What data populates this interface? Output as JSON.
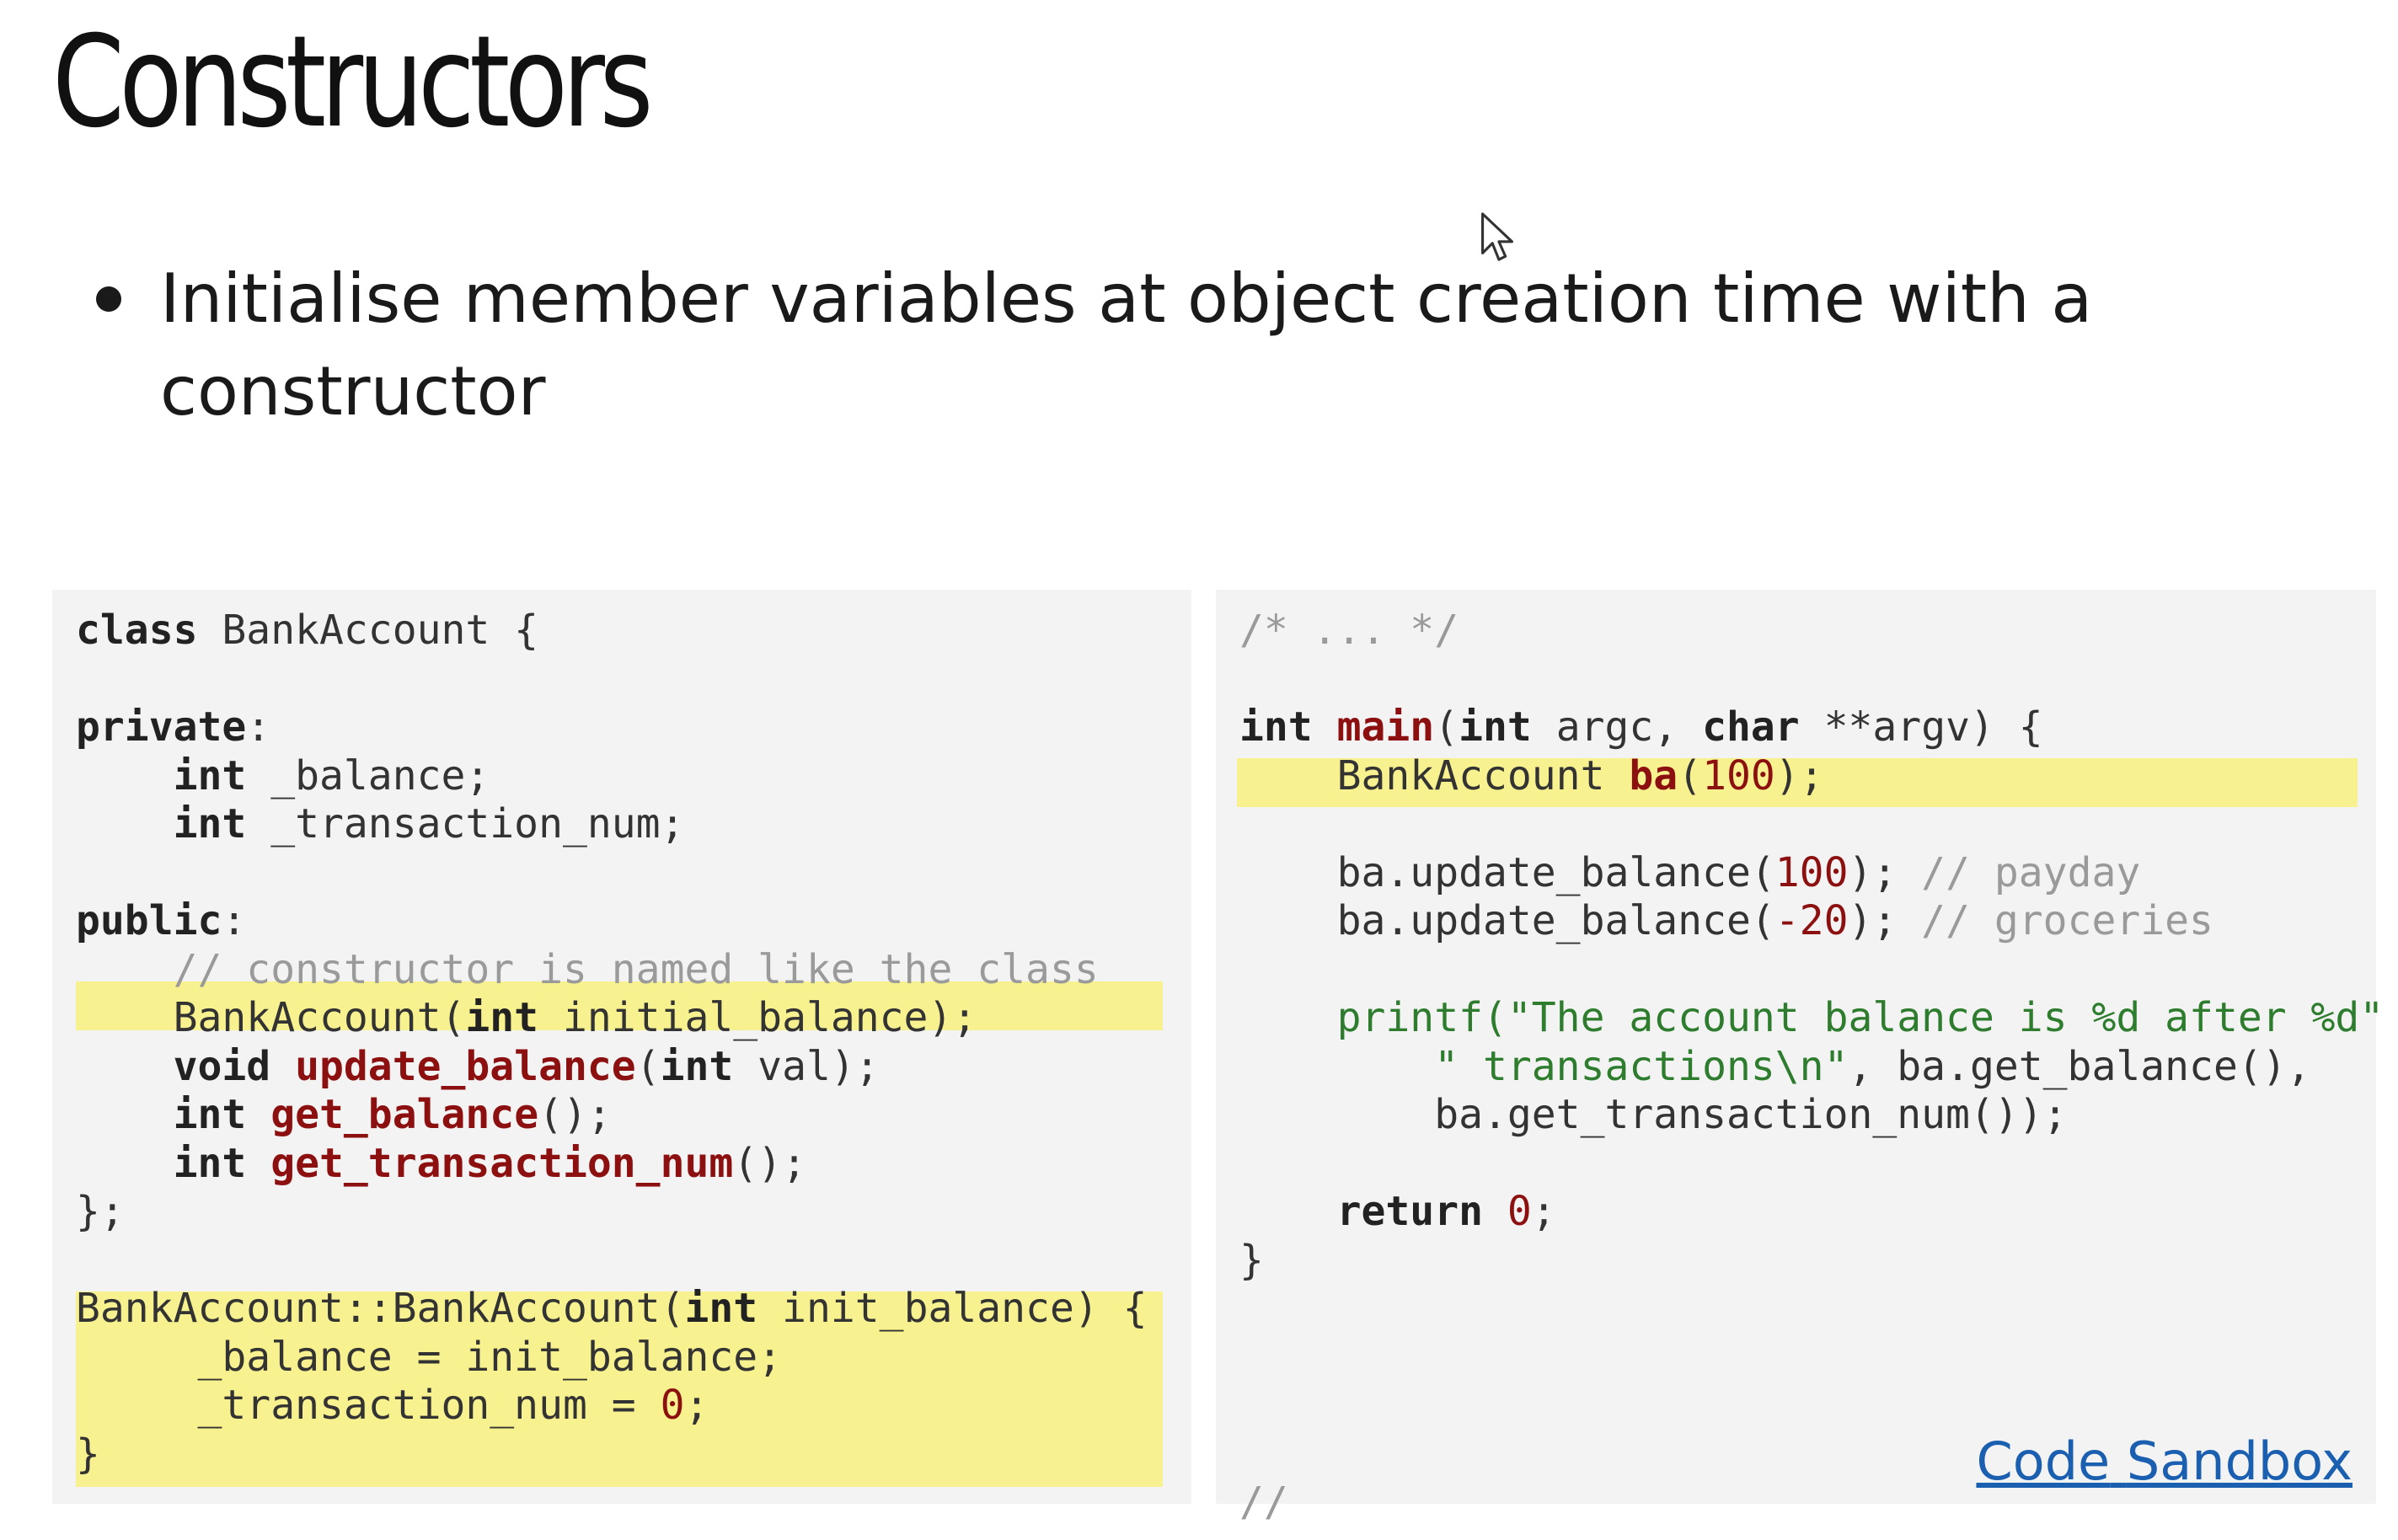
{
  "slide": {
    "title": "Constructors",
    "bullets": [
      "Initialise member variables at object creation time with a constructor"
    ]
  },
  "left_code": {
    "l01a": "class",
    "l01b": " BankAccount {",
    "l03a": "private",
    "l03b": ":",
    "l04a": "int",
    "l04b": " _balance;",
    "l05a": "int",
    "l05b": " _transaction_num;",
    "l07a": "public",
    "l07b": ":",
    "l08": "// constructor is named like the class",
    "l09a": "BankAccount(",
    "l09b": "int",
    "l09c": " initial_balance);",
    "l10a": "void",
    "l10b": "update_balance",
    "l10c": "(",
    "l10d": "int",
    "l10e": " val);",
    "l11a": "int",
    "l11b": "get_balance",
    "l11c": "();",
    "l12a": "int",
    "l12b": "get_transaction_num",
    "l12c": "();",
    "l13": "};",
    "l15a": "BankAccount::BankAccount(",
    "l15b": "int",
    "l15c": " init_balance) {",
    "l16": "_balance = init_balance;",
    "l17a": "_transaction_num = ",
    "l17b": "0",
    "l17c": ";",
    "l18": "}"
  },
  "right_code": {
    "r01": "/* ... */",
    "r03a": "int",
    "r03b": "main",
    "r03c": "(",
    "r03d": "int",
    "r03e": " argc, ",
    "r03f": "char",
    "r03g": " **argv) {",
    "r04a": "BankAccount ",
    "r04b": "ba",
    "r04c": "(",
    "r04d": "100",
    "r04e": ");",
    "r06a": "ba.update_balance(",
    "r06b": "100",
    "r06c": "); ",
    "r06d": "// payday",
    "r07a": "ba.update_balance(",
    "r07b": "-20",
    "r07c": "); ",
    "r07d": "// groceries",
    "r09a": "printf",
    "r09b": "(\"The account balance is %d after %d\"",
    "r10a": "\" transactions\\n\"",
    "r10b": ", ba.get_balance(),",
    "r11": "ba.get_transaction_num());",
    "r13a": "return",
    "r13b": " ",
    "r13c": "0",
    "r13d": ";",
    "r14": "}",
    "r19": "//"
  },
  "links": {
    "code": "Code",
    "sandbox": "Sandbox"
  },
  "colors": {
    "highlight": "#f8f18f",
    "panel_bg": "#f3f3f3",
    "keyword_function": "#8c1010",
    "string": "#2e7d2e",
    "comment": "#9a9a9a",
    "link": "#1b5fb0"
  },
  "icons": {
    "cursor": "mouse-pointer-icon"
  }
}
